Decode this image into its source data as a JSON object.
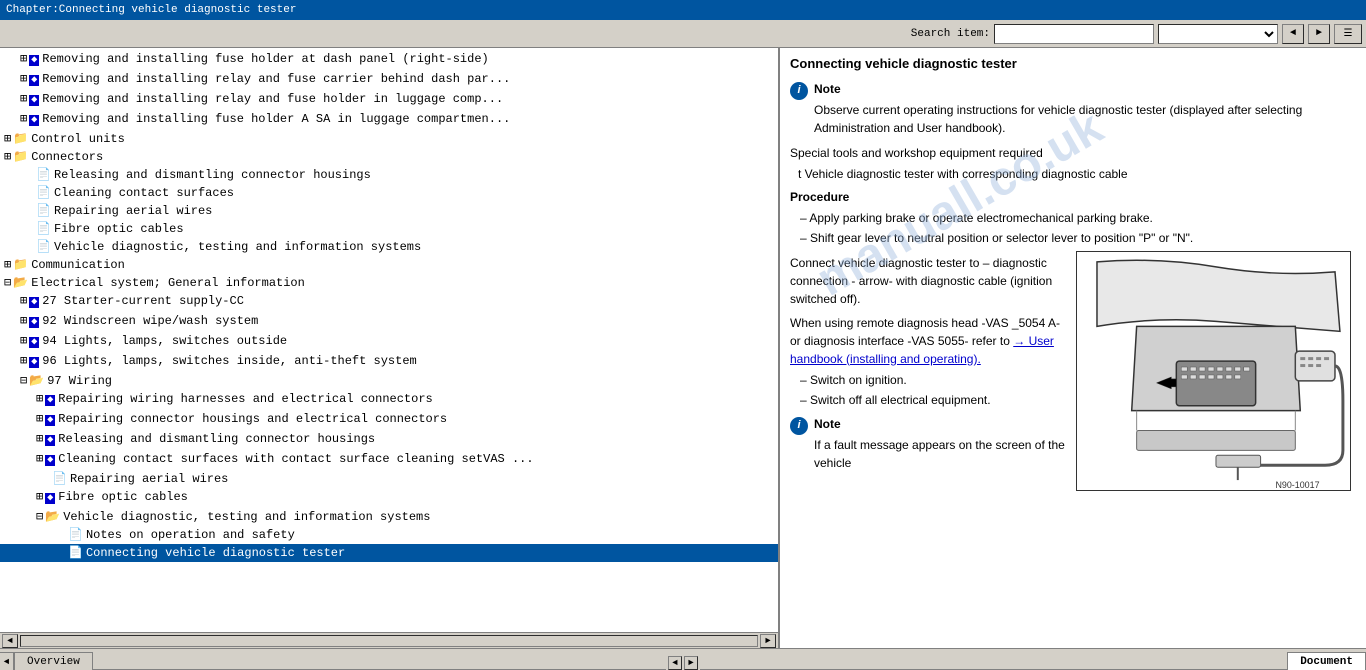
{
  "titleBar": {
    "text": "Chapter:Connecting vehicle diagnostic tester"
  },
  "toolbar": {
    "searchLabel": "Search item:",
    "searchPlaceholder": "",
    "searchValue": ""
  },
  "leftPanel": {
    "items": [
      {
        "indent": 1,
        "type": "folder-doc",
        "text": "Removing and installing fuse holder at dash panel (right-side)"
      },
      {
        "indent": 1,
        "type": "folder-doc",
        "text": "Removing and installing relay and fuse carrier behind dash par..."
      },
      {
        "indent": 1,
        "type": "folder-doc",
        "text": "Removing and installing relay and fuse holder in luggage comp..."
      },
      {
        "indent": 1,
        "type": "folder-doc",
        "text": "Removing and installing fuse holder A SA in luggage compartmen..."
      },
      {
        "indent": 0,
        "type": "folder",
        "text": "Control units"
      },
      {
        "indent": 0,
        "type": "folder",
        "text": "Connectors"
      },
      {
        "indent": 1,
        "type": "doc",
        "text": "Releasing and dismantling connector housings"
      },
      {
        "indent": 1,
        "type": "doc",
        "text": "Cleaning contact surfaces"
      },
      {
        "indent": 1,
        "type": "doc",
        "text": "Repairing aerial wires"
      },
      {
        "indent": 1,
        "type": "doc",
        "text": "Fibre optic cables"
      },
      {
        "indent": 1,
        "type": "doc",
        "text": "Vehicle diagnostic, testing and information systems"
      },
      {
        "indent": 0,
        "type": "folder",
        "text": "Communication"
      },
      {
        "indent": 0,
        "type": "folder-open",
        "text": "Electrical system; General information"
      },
      {
        "indent": 1,
        "type": "folder-doc",
        "text": "27 Starter-current supply-CC"
      },
      {
        "indent": 1,
        "type": "folder-doc",
        "text": "92 Windscreen wipe/wash system"
      },
      {
        "indent": 1,
        "type": "folder-doc",
        "text": "94 Lights, lamps, switches outside"
      },
      {
        "indent": 1,
        "type": "folder-doc",
        "text": "96 Lights, lamps, switches inside, anti-theft system"
      },
      {
        "indent": 1,
        "type": "folder-open",
        "text": "97 Wiring"
      },
      {
        "indent": 2,
        "type": "folder-doc",
        "text": "Repairing wiring harnesses and electrical connectors"
      },
      {
        "indent": 2,
        "type": "folder-doc",
        "text": "Repairing connector housings and electrical connectors"
      },
      {
        "indent": 2,
        "type": "folder-doc",
        "text": "Releasing and dismantling connector housings"
      },
      {
        "indent": 2,
        "type": "folder-doc",
        "text": "Cleaning contact surfaces with contact surface cleaning setVAS ..."
      },
      {
        "indent": 2,
        "type": "doc",
        "text": "Repairing aerial wires"
      },
      {
        "indent": 2,
        "type": "folder-doc",
        "text": "Fibre optic cables"
      },
      {
        "indent": 2,
        "type": "folder-open",
        "text": "Vehicle diagnostic, testing and information systems"
      },
      {
        "indent": 3,
        "type": "doc",
        "text": "Notes on operation and safety"
      },
      {
        "indent": 3,
        "type": "doc",
        "text": "Connecting vehicle diagnostic tester",
        "selected": true
      }
    ]
  },
  "rightPanel": {
    "title": "Connecting vehicle diagnostic tester",
    "noteLabel1": "Note",
    "noteText1": "Observe current operating instructions for vehicle diagnostic tester (displayed after selecting Administration and User handbook).",
    "specialToolsLabel": "Special tools and workshop equipment required",
    "toolItem": "t  Vehicle diagnostic tester with corresponding diagnostic cable",
    "procedureLabel": "Procedure",
    "steps": [
      "Apply parking brake or operate electromechanical parking brake.",
      "Shift gear lever to neutral position or selector lever to position \"P\" or \"N\"."
    ],
    "connectText": "Connect vehicle diagnostic tester to – diagnostic connection - arrow- with diagnostic cable (ignition switched off).",
    "remoteText": "When using remote diagnosis head -VAS _5054 A- or diagnosis interface -VAS 5055- refer to",
    "linkText": "→ User handbook (installing and operating).",
    "step3": "Switch on ignition.",
    "step4": "Switch off all electrical equipment.",
    "noteLabel2": "Note",
    "noteText2": "If a fault message appears on the screen of the vehicle",
    "diagramLabel": "N90-10017",
    "watermarkText": "manuall.co.uk"
  },
  "bottomTabs": {
    "left": {
      "overview": "Overview"
    },
    "right": {
      "document": "Document"
    }
  }
}
